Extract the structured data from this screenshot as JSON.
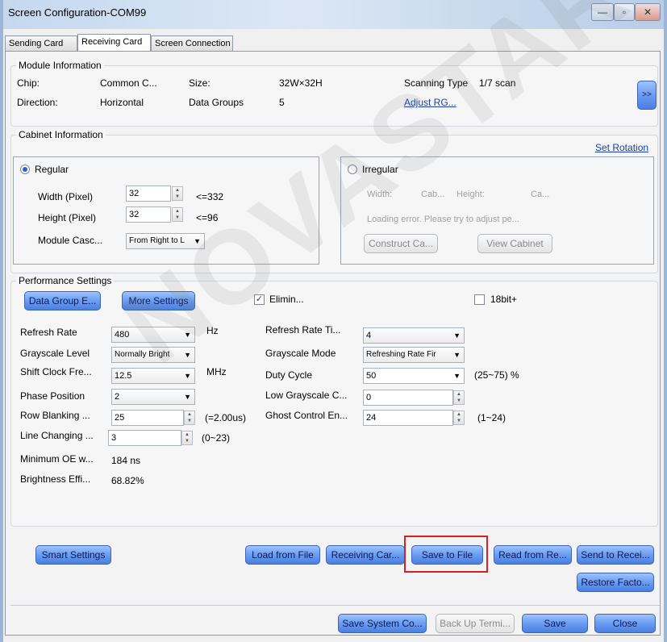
{
  "window": {
    "title": "Screen Configuration-COM99",
    "minimize_glyph": "—",
    "maximize_glyph": "▫",
    "close_glyph": "✕"
  },
  "tabs": [
    "Sending Card",
    "Receiving Card",
    "Screen Connection"
  ],
  "active_tab": "Receiving Card",
  "module_info": {
    "title": "Module Information",
    "chip_label": "Chip:",
    "chip_value": "Common C...",
    "size_label": "Size:",
    "size_value": "32W×32H",
    "scanning_type_label": "Scanning Type",
    "scanning_type_value": "1/7 scan",
    "direction_label": "Direction:",
    "direction_value": "Horizontal",
    "data_groups_label": "Data Groups",
    "data_groups_value": "5",
    "adjust_rg_link": "Adjust RG...",
    "more_button": ">>"
  },
  "cabinet_info": {
    "title": "Cabinet Information",
    "set_rotation_link": "Set Rotation",
    "regular": {
      "label": "Regular",
      "selected": true,
      "width_label": "Width (Pixel)",
      "width_value": "32",
      "width_limit": "<=332",
      "height_label": "Height (Pixel)",
      "height_value": "32",
      "height_limit": "<=96",
      "cascade_label": "Module Casc...",
      "cascade_value": "From Right to L"
    },
    "irregular": {
      "label": "Irregular",
      "selected": false,
      "width_label": "Width:",
      "cab_text": "Cab...",
      "height_label": "Height:",
      "ca_text": "Ca...",
      "error_text": "Loading error. Please try to adjust pe...",
      "construct_button": "Construct Ca...",
      "view_button": "View Cabinet"
    }
  },
  "performance": {
    "title": "Performance Settings",
    "data_group_button": "Data Group E...",
    "more_settings_button": "More Settings",
    "elimin_label": "Elimin...",
    "elimin_checked": true,
    "bit18_label": "18bit+",
    "bit18_checked": false,
    "refresh_rate_label": "Refresh Rate",
    "refresh_rate_value": "480",
    "refresh_rate_unit": "Hz",
    "grayscale_level_label": "Grayscale Level",
    "grayscale_level_value": "Normally Bright",
    "shift_clock_label": "Shift Clock Fre...",
    "shift_clock_value": "12.5",
    "shift_clock_unit": "MHz",
    "phase_position_label": "Phase Position",
    "phase_position_value": "2",
    "row_blanking_label": "Row Blanking ...",
    "row_blanking_value": "25",
    "row_blanking_note": "(=2.00us)",
    "line_changing_label": "Line Changing ...",
    "line_changing_value": "3",
    "line_changing_range": "(0~23)",
    "min_oe_label": "Minimum OE w...",
    "min_oe_value": "184 ns",
    "brightness_eff_label": "Brightness Effi...",
    "brightness_eff_value": "68.82%",
    "refresh_times_label": "Refresh Rate Ti...",
    "refresh_times_value": "4",
    "grayscale_mode_label": "Grayscale Mode",
    "grayscale_mode_value": "Refreshing Rate Fir",
    "duty_cycle_label": "Duty Cycle",
    "duty_cycle_value": "50",
    "duty_cycle_range": "(25~75) %",
    "low_grayscale_label": "Low Grayscale C...",
    "low_grayscale_value": "0",
    "ghost_control_label": "Ghost Control En...",
    "ghost_control_value": "24",
    "ghost_control_range": "(1~24)"
  },
  "actions": {
    "smart_settings": "Smart Settings",
    "load_from_file": "Load from File",
    "receiving_card": "Receiving Car...",
    "save_to_file": "Save to File",
    "read_from_receiving": "Read from Re...",
    "send_to_receiving": "Send to Recei...",
    "restore_factory": "Restore Facto..."
  },
  "footer": {
    "save_system_config": "Save System Co...",
    "back_up_terminal": "Back Up Termi...",
    "save": "Save",
    "close": "Close"
  },
  "watermark": "NOVASTAR TECH",
  "colors": {
    "button_blue": "#6a9cf0",
    "highlight_red": "#d42121",
    "link_blue": "#1a3ea8"
  }
}
